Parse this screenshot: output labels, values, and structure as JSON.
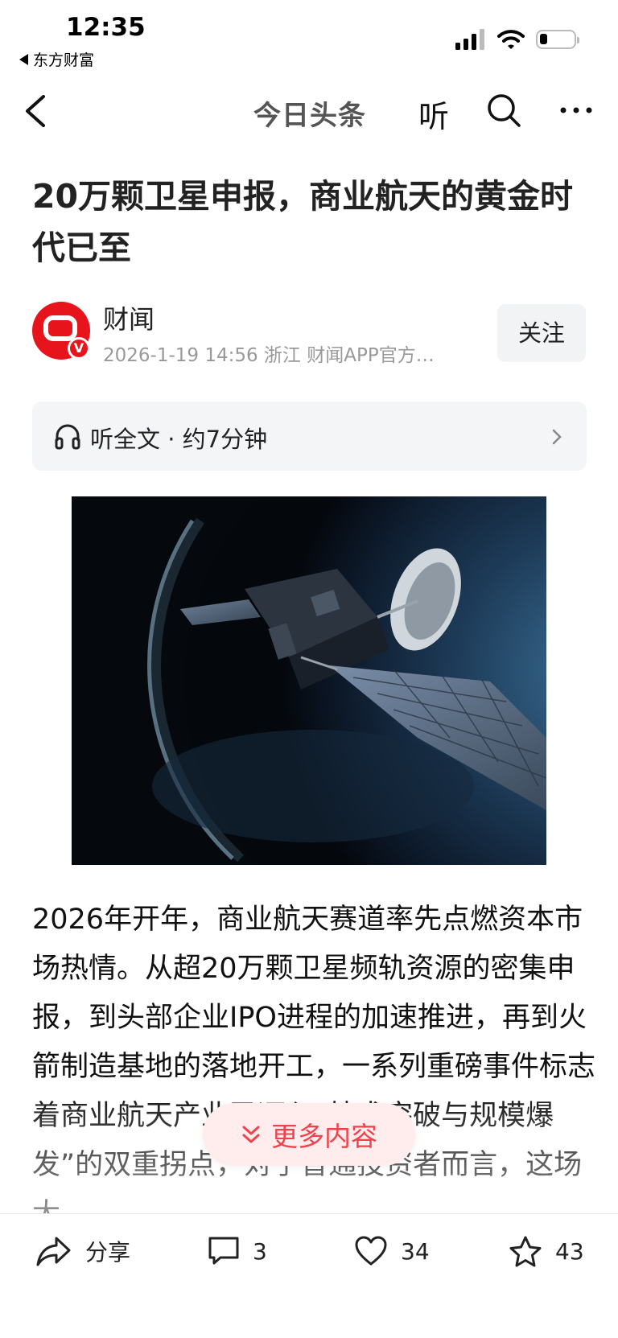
{
  "status": {
    "time": "12:35",
    "back_app": "东方财富"
  },
  "nav": {
    "title": "今日头条",
    "listen_label": "听"
  },
  "article": {
    "title": "20万颗卫星申报，商业航天的黄金时代已至",
    "author": "财闻",
    "meta": "2026-1-19  14:56  浙江  财闻APP官方…",
    "follow_label": "关注",
    "listen_bar": "听全文 · 约7分钟",
    "body": "2026年开年，商业航天赛道率先点燃资本市场热情。从超20万颗卫星频轨资源的密集申报，到头部企业IPO进程的加速推进，再到火箭制造基地的落地开工，一系列重磅事件标志着商业航天产业已迈入“技术突破与规模爆发”的双重拐点，对于普通投资者而言，这场大"
  },
  "more_button": {
    "label": "更多内容"
  },
  "bottom_bar": {
    "share_label": "分享",
    "comment_count": "3",
    "like_count": "34",
    "favorite_count": "43"
  },
  "colors": {
    "accent": "#f0424c",
    "avatar": "#e8141c"
  }
}
